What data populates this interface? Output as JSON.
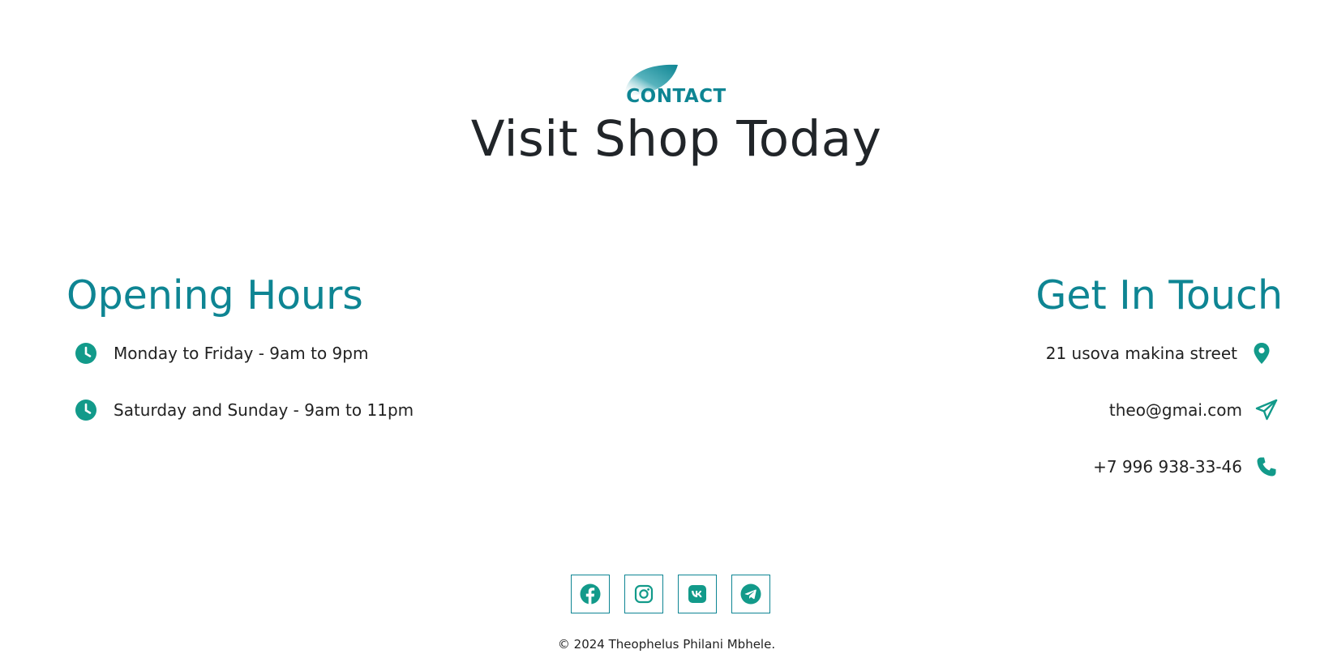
{
  "header": {
    "eyebrow": "CONTACT",
    "title": "Visit Shop Today"
  },
  "opening_hours": {
    "title": "Opening Hours",
    "items": [
      {
        "text": "Monday to Friday - 9am to 9pm",
        "icon": "clock-icon"
      },
      {
        "text": "Saturday and Sunday - 9am to 11pm",
        "icon": "clock-icon"
      }
    ]
  },
  "get_in_touch": {
    "title": "Get In Touch",
    "items": [
      {
        "text": "21 usova makina street",
        "icon": "location-pin-icon"
      },
      {
        "text": "theo@gmai.com",
        "icon": "paper-plane-icon"
      },
      {
        "text": "+7 996 938-33-46",
        "icon": "phone-icon"
      }
    ]
  },
  "social": [
    {
      "name": "facebook",
      "icon": "facebook-icon"
    },
    {
      "name": "instagram",
      "icon": "instagram-icon"
    },
    {
      "name": "vk",
      "icon": "vk-icon"
    },
    {
      "name": "telegram",
      "icon": "telegram-icon"
    }
  ],
  "footer": {
    "copyright": "© 2024 Theophelus Philani Mbhele."
  },
  "colors": {
    "accent": "#0e8593",
    "icon_teal": "#129a8a",
    "text": "#222222",
    "title": "#212529"
  }
}
